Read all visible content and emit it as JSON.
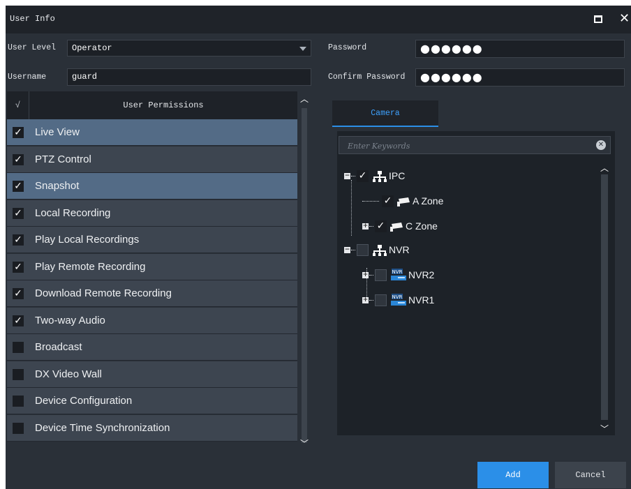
{
  "window": {
    "title": "User Info"
  },
  "form": {
    "user_level_label": "User Level",
    "user_level_value": "Operator",
    "username_label": "Username",
    "username_value": "guard",
    "password_label": "Password",
    "password_value": "●●●●●●",
    "confirm_password_label": "Confirm Password",
    "confirm_password_value": "●●●●●●"
  },
  "permissions": {
    "header_check": "√",
    "header_title": "User Permissions",
    "items": [
      {
        "label": "Live View",
        "checked": true,
        "selected": true
      },
      {
        "label": "PTZ Control",
        "checked": true,
        "selected": false
      },
      {
        "label": "Snapshot",
        "checked": true,
        "selected": true
      },
      {
        "label": "Local Recording",
        "checked": true,
        "selected": false
      },
      {
        "label": "Play Local Recordings",
        "checked": true,
        "selected": false
      },
      {
        "label": "Play Remote Recording",
        "checked": true,
        "selected": false
      },
      {
        "label": "Download Remote Recording",
        "checked": true,
        "selected": false
      },
      {
        "label": "Two-way Audio",
        "checked": true,
        "selected": false
      },
      {
        "label": "Broadcast",
        "checked": false,
        "selected": false
      },
      {
        "label": "DX Video Wall",
        "checked": false,
        "selected": false
      },
      {
        "label": "Device Configuration",
        "checked": false,
        "selected": false
      },
      {
        "label": "Device Time Synchronization",
        "checked": false,
        "selected": false
      }
    ]
  },
  "resource_tabs": [
    {
      "label": "Camera",
      "active": true
    }
  ],
  "search": {
    "placeholder": "Enter Keywords"
  },
  "tree": {
    "ipc": {
      "label": "IPC",
      "checked": true,
      "icon": "network-icon"
    },
    "a_zone": {
      "label": "A Zone",
      "checked": true,
      "icon": "camera-icon"
    },
    "c_zone": {
      "label": "C Zone",
      "checked": true,
      "icon": "camera-icon"
    },
    "nvr": {
      "label": "NVR",
      "checked": false,
      "icon": "network-icon"
    },
    "nvr2": {
      "label": "NVR2",
      "checked": false,
      "icon": "nvr-device-icon"
    },
    "nvr1": {
      "label": "NVR1",
      "checked": false,
      "icon": "nvr-device-icon"
    },
    "nvr_icon_text": "NVR"
  },
  "buttons": {
    "add": "Add",
    "cancel": "Cancel"
  },
  "colors": {
    "accent": "#2b8fe8",
    "selected_row": "#536b86",
    "row": "#3d4550",
    "background": "#2a3038"
  }
}
